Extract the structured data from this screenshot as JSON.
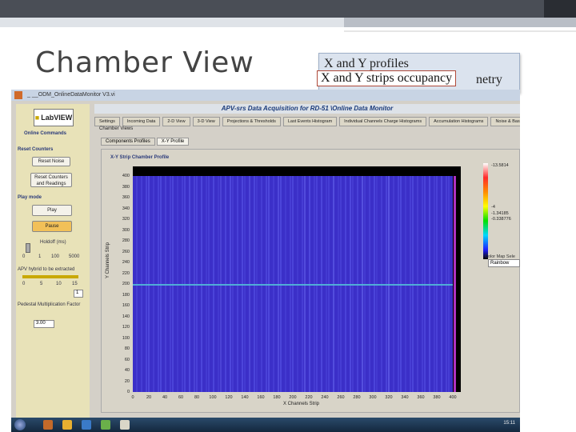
{
  "slide": {
    "title": "Chamber View",
    "callout_line1": "X and Y profiles",
    "callout_line2_tail": "netry",
    "callout_overlay": "X and Y strips occupancy"
  },
  "window": {
    "title": "_ __ODM_OnlineDataMonitor V3.vi"
  },
  "app": {
    "title": "APV-srs Data Acquisition for RD-51 \\Online Data Monitor",
    "logo_text": "LabVIEW",
    "left": {
      "online_commands": "Online Commands",
      "reset_counters": "Reset Counters",
      "reset_noise": "Reset Noise",
      "reset_counters_readings": "Reset Counters and Readings",
      "play_mode": "Play mode",
      "play": "Play",
      "pause": "Pause",
      "holdoff_label": "Holdoff (ms)",
      "holdoff_ticks": [
        "0",
        "1",
        "100",
        "5000"
      ],
      "apv_label": "APV hybrid to be extracted",
      "apv_ticks": [
        "0",
        "5",
        "10",
        "15"
      ],
      "apv_value": "1",
      "pedestal_label": "Pedestal Multiplication Factor",
      "pedestal_value": "3.00"
    },
    "tabs": [
      "Settings",
      "Incoming Data",
      "2-D View",
      "3-D View",
      "Projections & Thresholds",
      "Last Events Histogram",
      "Individual Channels Charge Histograms",
      "Accumulation Histograms",
      "Noise & Base"
    ],
    "chamber_views_label": "Chamber Views",
    "subtabs": [
      "Components Profiles",
      "X-Y Profile"
    ],
    "plot_title": "X-Y Strip Chamber Profile",
    "colormap_label": "Color Map Sele",
    "colormap_value": "Rainbow",
    "clock": "15:11"
  },
  "chart_data": {
    "type": "heatmap",
    "title": "X-Y Strip Chamber Profile",
    "xlabel": "X Channels Strip",
    "ylabel": "Y Channels Strip",
    "x_ticks": [
      "0",
      "20",
      "40",
      "60",
      "80",
      "100",
      "120",
      "140",
      "160",
      "180",
      "200",
      "220",
      "240",
      "260",
      "280",
      "300",
      "320",
      "340",
      "360",
      "380",
      "400"
    ],
    "y_ticks": [
      "400",
      "380",
      "360",
      "340",
      "320",
      "300",
      "280",
      "260",
      "240",
      "220",
      "200",
      "180",
      "160",
      "140",
      "120",
      "100",
      "80",
      "60",
      "40",
      "20",
      "0"
    ],
    "xlim": [
      0,
      400
    ],
    "ylim": [
      0,
      400
    ],
    "colorbar_labels": [
      "-13.5814",
      "-4",
      "-1.34185",
      "-0.338776"
    ],
    "high_occupancy_y_row": 200,
    "colors": {
      "background": "#3b2fc8",
      "hot_row": "#53c1d8",
      "edge": "#b030c0"
    }
  }
}
